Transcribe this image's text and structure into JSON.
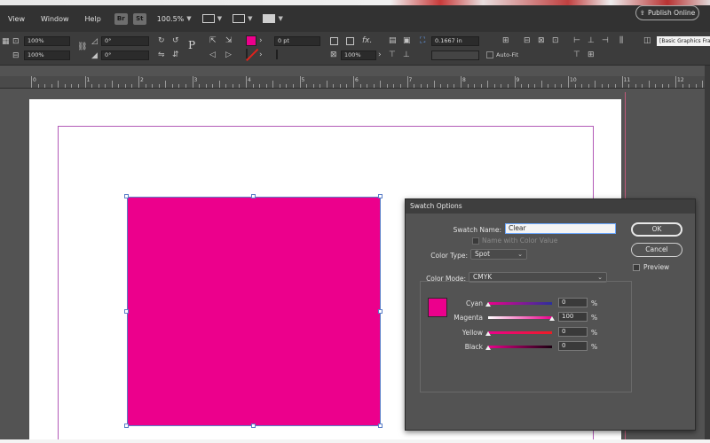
{
  "menu": {
    "items": [
      "View",
      "Window",
      "Help"
    ],
    "badges": [
      "Br",
      "St"
    ],
    "zoom": "100.5%",
    "publish_label": "Publish Online"
  },
  "control": {
    "scale_x": "100%",
    "scale_y": "100%",
    "rotate": "0°",
    "shear": "0°",
    "stroke_weight": "0 pt",
    "opacity": "100%",
    "offset": "0.1667 in",
    "autofit_label": "Auto-Fit",
    "workspace": "[Basic Graphics Frame]",
    "fill_color": "#ec008c"
  },
  "ruler": {
    "labels": [
      "0",
      "1",
      "2",
      "3",
      "4",
      "5",
      "6",
      "7",
      "8",
      "9",
      "10",
      "11",
      "12"
    ]
  },
  "dialog": {
    "title": "Swatch Options",
    "swatch_name_label": "Swatch Name:",
    "swatch_name_value": "Clear",
    "name_with_value_label": "Name with Color Value",
    "color_type_label": "Color Type:",
    "color_type_value": "Spot",
    "color_mode_label": "Color Mode:",
    "color_mode_value": "CMYK",
    "ok_label": "OK",
    "cancel_label": "Cancel",
    "preview_label": "Preview",
    "channels": [
      {
        "label": "Cyan",
        "value": "0"
      },
      {
        "label": "Magenta",
        "value": "100"
      },
      {
        "label": "Yellow",
        "value": "0"
      },
      {
        "label": "Black",
        "value": "0"
      }
    ],
    "percent": "%"
  }
}
